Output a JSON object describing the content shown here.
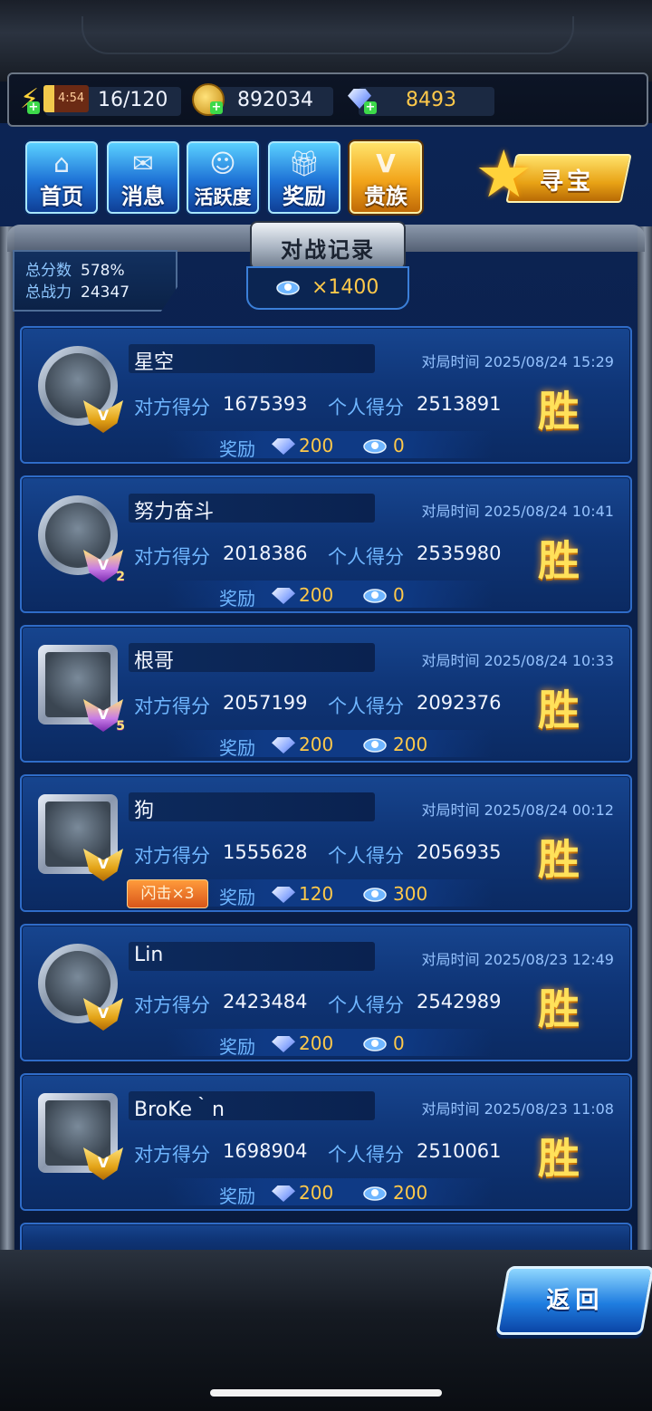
{
  "resources": {
    "timer": "4:54",
    "energy": "16/120",
    "gold": "892034",
    "diamonds": "8493"
  },
  "nav": {
    "home": "首页",
    "messages": "消息",
    "activity": "活跃度",
    "rewards": "奖励",
    "noble": "贵族",
    "treasure": "寻宝"
  },
  "panel": {
    "title": "对战记录",
    "total_score_label": "总分数",
    "total_score_value": "578%",
    "total_power_label": "总战力",
    "total_power_value": "24347",
    "cost": "×1400"
  },
  "labels": {
    "opponent_score": "对方得分",
    "my_score": "个人得分",
    "reward": "奖励",
    "win": "胜",
    "time_prefix": "对局时间"
  },
  "records": [
    {
      "name": "星空",
      "time": "对局时间 2025/08/24 15:29",
      "opponent": "1675393",
      "mine": "2513891",
      "gems": "200",
      "items": "0",
      "rank": "",
      "flash": ""
    },
    {
      "name": "努力奋斗",
      "time": "对局时间 2025/08/24 10:41",
      "opponent": "2018386",
      "mine": "2535980",
      "gems": "200",
      "items": "0",
      "rank": "2",
      "flash": ""
    },
    {
      "name": "根哥",
      "time": "对局时间 2025/08/24 10:33",
      "opponent": "2057199",
      "mine": "2092376",
      "gems": "200",
      "items": "200",
      "rank": "5",
      "flash": ""
    },
    {
      "name": "狗",
      "time": "对局时间 2025/08/24 00:12",
      "opponent": "1555628",
      "mine": "2056935",
      "gems": "120",
      "items": "300",
      "rank": "",
      "flash": "闪击×3"
    },
    {
      "name": "Lin",
      "time": "对局时间 2025/08/23 12:49",
      "opponent": "2423484",
      "mine": "2542989",
      "gems": "200",
      "items": "0",
      "rank": "",
      "flash": ""
    },
    {
      "name": "BroKe｀n",
      "time": "对局时间 2025/08/23 11:08",
      "opponent": "1698904",
      "mine": "2510061",
      "gems": "200",
      "items": "200",
      "rank": "",
      "flash": ""
    }
  ],
  "back": "返回"
}
